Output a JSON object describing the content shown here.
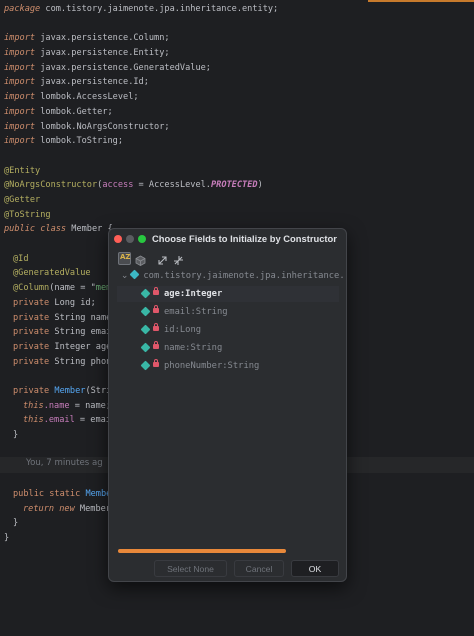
{
  "editor": {
    "lines": {
      "l1": {
        "kw": "package",
        "rest": " com.tistory.jaimenote.jpa.inheritance.entity;"
      },
      "imports": [
        "javax.persistence.Column;",
        "javax.persistence.Entity;",
        "javax.persistence.GeneratedValue;",
        "javax.persistence.Id;",
        "lombok.AccessLevel;",
        "lombok.Getter;",
        "lombok.NoArgsConstructor;",
        "lombok.ToString;"
      ],
      "import_kw": "import",
      "ann_entity": "@Entity",
      "ann_noargs": "@NoArgsConstructor",
      "noargs_open": "(",
      "noargs_access": "access",
      "noargs_eq": " = AccessLevel.",
      "noargs_const": "PROTECTED",
      "noargs_close": ")",
      "ann_getter": "@Getter",
      "ann_tostring": "@ToString",
      "class_kw": "public class",
      "class_name": " Member {",
      "ann_id": "@Id",
      "ann_genval": "@GeneratedValue",
      "ann_column": "@Column",
      "column_args": "(name = \"",
      "column_str": "memb",
      "private_kw": "private",
      "field_id": " Long id;",
      "field_name": " String name;",
      "field_email": " String email",
      "field_age": " Integer age;",
      "field_phone": " String phone",
      "ctor_kw": "private",
      "ctor_name": " Member",
      "ctor_args": "(Strin",
      "this_kw": "this",
      "this_name_a": ".name",
      "this_name_b": " = name;",
      "this_email_a": ".email",
      "this_email_b": " = email",
      "close1": "}",
      "static_kw": "public static",
      "static_name": " Member",
      "return_kw": "return new",
      "return_rest": " Member(",
      "close2": "}",
      "close3": "}"
    },
    "blame": "You, 7 minutes ag"
  },
  "dialog": {
    "title": "Choose Fields to Initialize by Constructor",
    "toolbar": {
      "sort_label": "AZ"
    },
    "tree_root": "com.tistory.jaimenote.jpa.inheritance.",
    "fields": [
      {
        "label": "age:Integer",
        "selected": true
      },
      {
        "label": "email:String",
        "selected": false
      },
      {
        "label": "id:Long",
        "selected": false
      },
      {
        "label": "name:String",
        "selected": false
      },
      {
        "label": "phoneNumber:String",
        "selected": false
      }
    ],
    "buttons": {
      "select_none": "Select None",
      "cancel": "Cancel",
      "ok": "OK"
    }
  },
  "colors": {
    "accent": "#e8883a",
    "background": "#1e1f22",
    "dialog_bg": "#2b2d30"
  }
}
